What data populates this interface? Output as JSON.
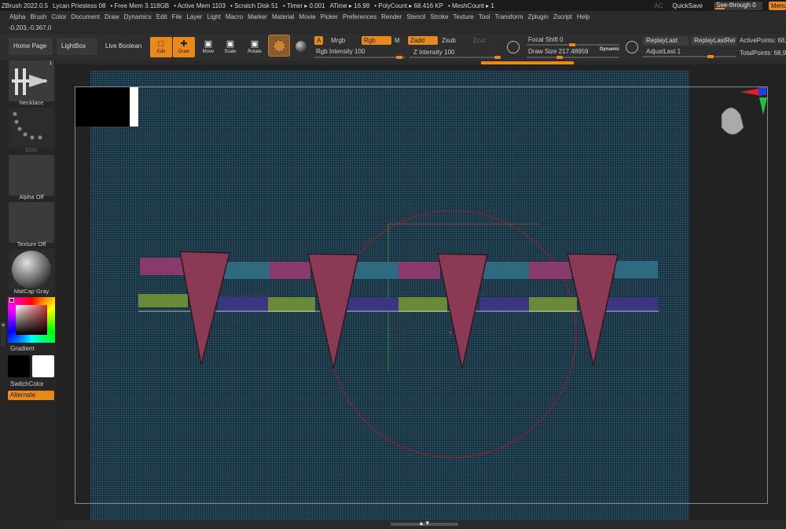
{
  "titlebar": {
    "app": "ZBrush 2022.0.5",
    "document": "Lycan Priestess 08",
    "free_mem": "• Free Mem 3.118GB",
    "active_mem": "• Active Mem 1103",
    "scratch": "• Scratch Disk 51",
    "timer": "• Timer ▸ 0.001",
    "atime": "ATime ▸ 16.98",
    "polycount": "• PolyCount ▸ 68.416 KP",
    "meshcount": "• MeshCount ▸ 1",
    "ac": "AC",
    "quicksave": "QuickSave",
    "see_through": "See-through  0",
    "menus_button": "Menus"
  },
  "menubar": [
    "Alpha",
    "Brush",
    "Color",
    "Document",
    "Draw",
    "Dynamics",
    "Edit",
    "File",
    "Layer",
    "Light",
    "Macro",
    "Marker",
    "Material",
    "Movie",
    "Picker",
    "Preferences",
    "Render",
    "Stencil",
    "Stroke",
    "Texture",
    "Tool",
    "Transform",
    "Zplugin",
    "Zscript",
    "Help"
  ],
  "coords": "-0.203,-0.367,0",
  "toolbar": {
    "home_page": "Home Page",
    "lightbox": "LightBox",
    "live_boolean": "Live Boolean",
    "edit": "Edit",
    "draw": "Draw",
    "move": "Move",
    "scale": "Scale",
    "rotate": "Rotate",
    "a": "A",
    "mrgb": "Mrgb",
    "rgb": "Rgb",
    "m": "M",
    "zadd": "Zadd",
    "zsub": "Zsub",
    "zcut": "Zcut",
    "rgb_intensity": "Rgb Intensity 100",
    "z_intensity": "Z Intensity 100",
    "focal_shift": "Focal Shift 0",
    "draw_size": "Draw Size 217.48959",
    "dynamic": "Dynamic",
    "replay_last": "ReplayLast",
    "replay_last_rel": "ReplayLastRel",
    "adjust_last": "AdjustLast 1",
    "active_points": "ActivePoints: 68,9",
    "total_points": "TotalPoints: 68,9"
  },
  "left_panel": {
    "brush_label": "Necklace",
    "brush_count": "1",
    "stroke_label": "Dots",
    "alpha_label": "Alpha Off",
    "texture_label": "Texture Off",
    "material_label": "MatCap Gray",
    "gradient_label": "Gradient",
    "switch_color": "SwitchColor",
    "alternate": "Alternate"
  },
  "colors": {
    "accent": "#e8891a",
    "viewport": "#173040",
    "beads_pink": "#8a3a6a",
    "beads_teal": "#2f6a80",
    "beads_green": "#6a8a3a",
    "beads_purple": "#3a3680",
    "triangles": "#8a3a55",
    "brush_circle": "#8a2030"
  }
}
